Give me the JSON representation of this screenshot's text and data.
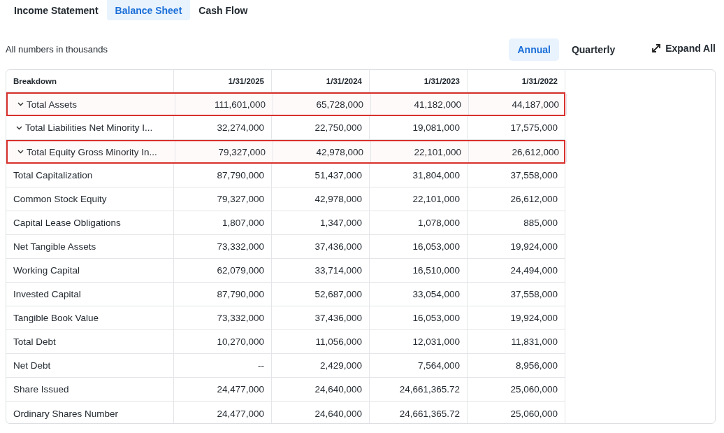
{
  "tabs": [
    {
      "label": "Income Statement",
      "selected": false
    },
    {
      "label": "Balance Sheet",
      "selected": true
    },
    {
      "label": "Cash Flow",
      "selected": false
    }
  ],
  "note": "All numbers in thousands",
  "period_toggle": [
    {
      "label": "Annual",
      "selected": true
    },
    {
      "label": "Quarterly",
      "selected": false
    }
  ],
  "expand_all": "Expand All",
  "table": {
    "columns": [
      "Breakdown",
      "1/31/2025",
      "1/31/2024",
      "1/31/2023",
      "1/31/2022"
    ],
    "rows": [
      {
        "label": "Total Assets",
        "expandable": true,
        "highlighted": true,
        "values": [
          "111,601,000",
          "65,728,000",
          "41,182,000",
          "44,187,000"
        ]
      },
      {
        "label": "Total Liabilities Net Minority I...",
        "expandable": true,
        "highlighted": false,
        "values": [
          "32,274,000",
          "22,750,000",
          "19,081,000",
          "17,575,000"
        ]
      },
      {
        "label": "Total Equity Gross Minority In...",
        "expandable": true,
        "highlighted": true,
        "values": [
          "79,327,000",
          "42,978,000",
          "22,101,000",
          "26,612,000"
        ]
      },
      {
        "label": "Total Capitalization",
        "expandable": false,
        "highlighted": false,
        "values": [
          "87,790,000",
          "51,437,000",
          "31,804,000",
          "37,558,000"
        ]
      },
      {
        "label": "Common Stock Equity",
        "expandable": false,
        "highlighted": false,
        "values": [
          "79,327,000",
          "42,978,000",
          "22,101,000",
          "26,612,000"
        ]
      },
      {
        "label": "Capital Lease Obligations",
        "expandable": false,
        "highlighted": false,
        "values": [
          "1,807,000",
          "1,347,000",
          "1,078,000",
          "885,000"
        ]
      },
      {
        "label": "Net Tangible Assets",
        "expandable": false,
        "highlighted": false,
        "values": [
          "73,332,000",
          "37,436,000",
          "16,053,000",
          "19,924,000"
        ]
      },
      {
        "label": "Working Capital",
        "expandable": false,
        "highlighted": false,
        "values": [
          "62,079,000",
          "33,714,000",
          "16,510,000",
          "24,494,000"
        ]
      },
      {
        "label": "Invested Capital",
        "expandable": false,
        "highlighted": false,
        "values": [
          "87,790,000",
          "52,687,000",
          "33,054,000",
          "37,558,000"
        ]
      },
      {
        "label": "Tangible Book Value",
        "expandable": false,
        "highlighted": false,
        "values": [
          "73,332,000",
          "37,436,000",
          "16,053,000",
          "19,924,000"
        ]
      },
      {
        "label": "Total Debt",
        "expandable": false,
        "highlighted": false,
        "values": [
          "10,270,000",
          "11,056,000",
          "12,031,000",
          "11,831,000"
        ]
      },
      {
        "label": "Net Debt",
        "expandable": false,
        "highlighted": false,
        "values": [
          "--",
          "2,429,000",
          "7,564,000",
          "8,956,000"
        ]
      },
      {
        "label": "Share Issued",
        "expandable": false,
        "highlighted": false,
        "values": [
          "24,477,000",
          "24,640,000",
          "24,661,365.72",
          "25,060,000"
        ]
      },
      {
        "label": "Ordinary Shares Number",
        "expandable": false,
        "highlighted": false,
        "values": [
          "24,477,000",
          "24,640,000",
          "24,661,365.72",
          "25,060,000"
        ]
      }
    ]
  }
}
